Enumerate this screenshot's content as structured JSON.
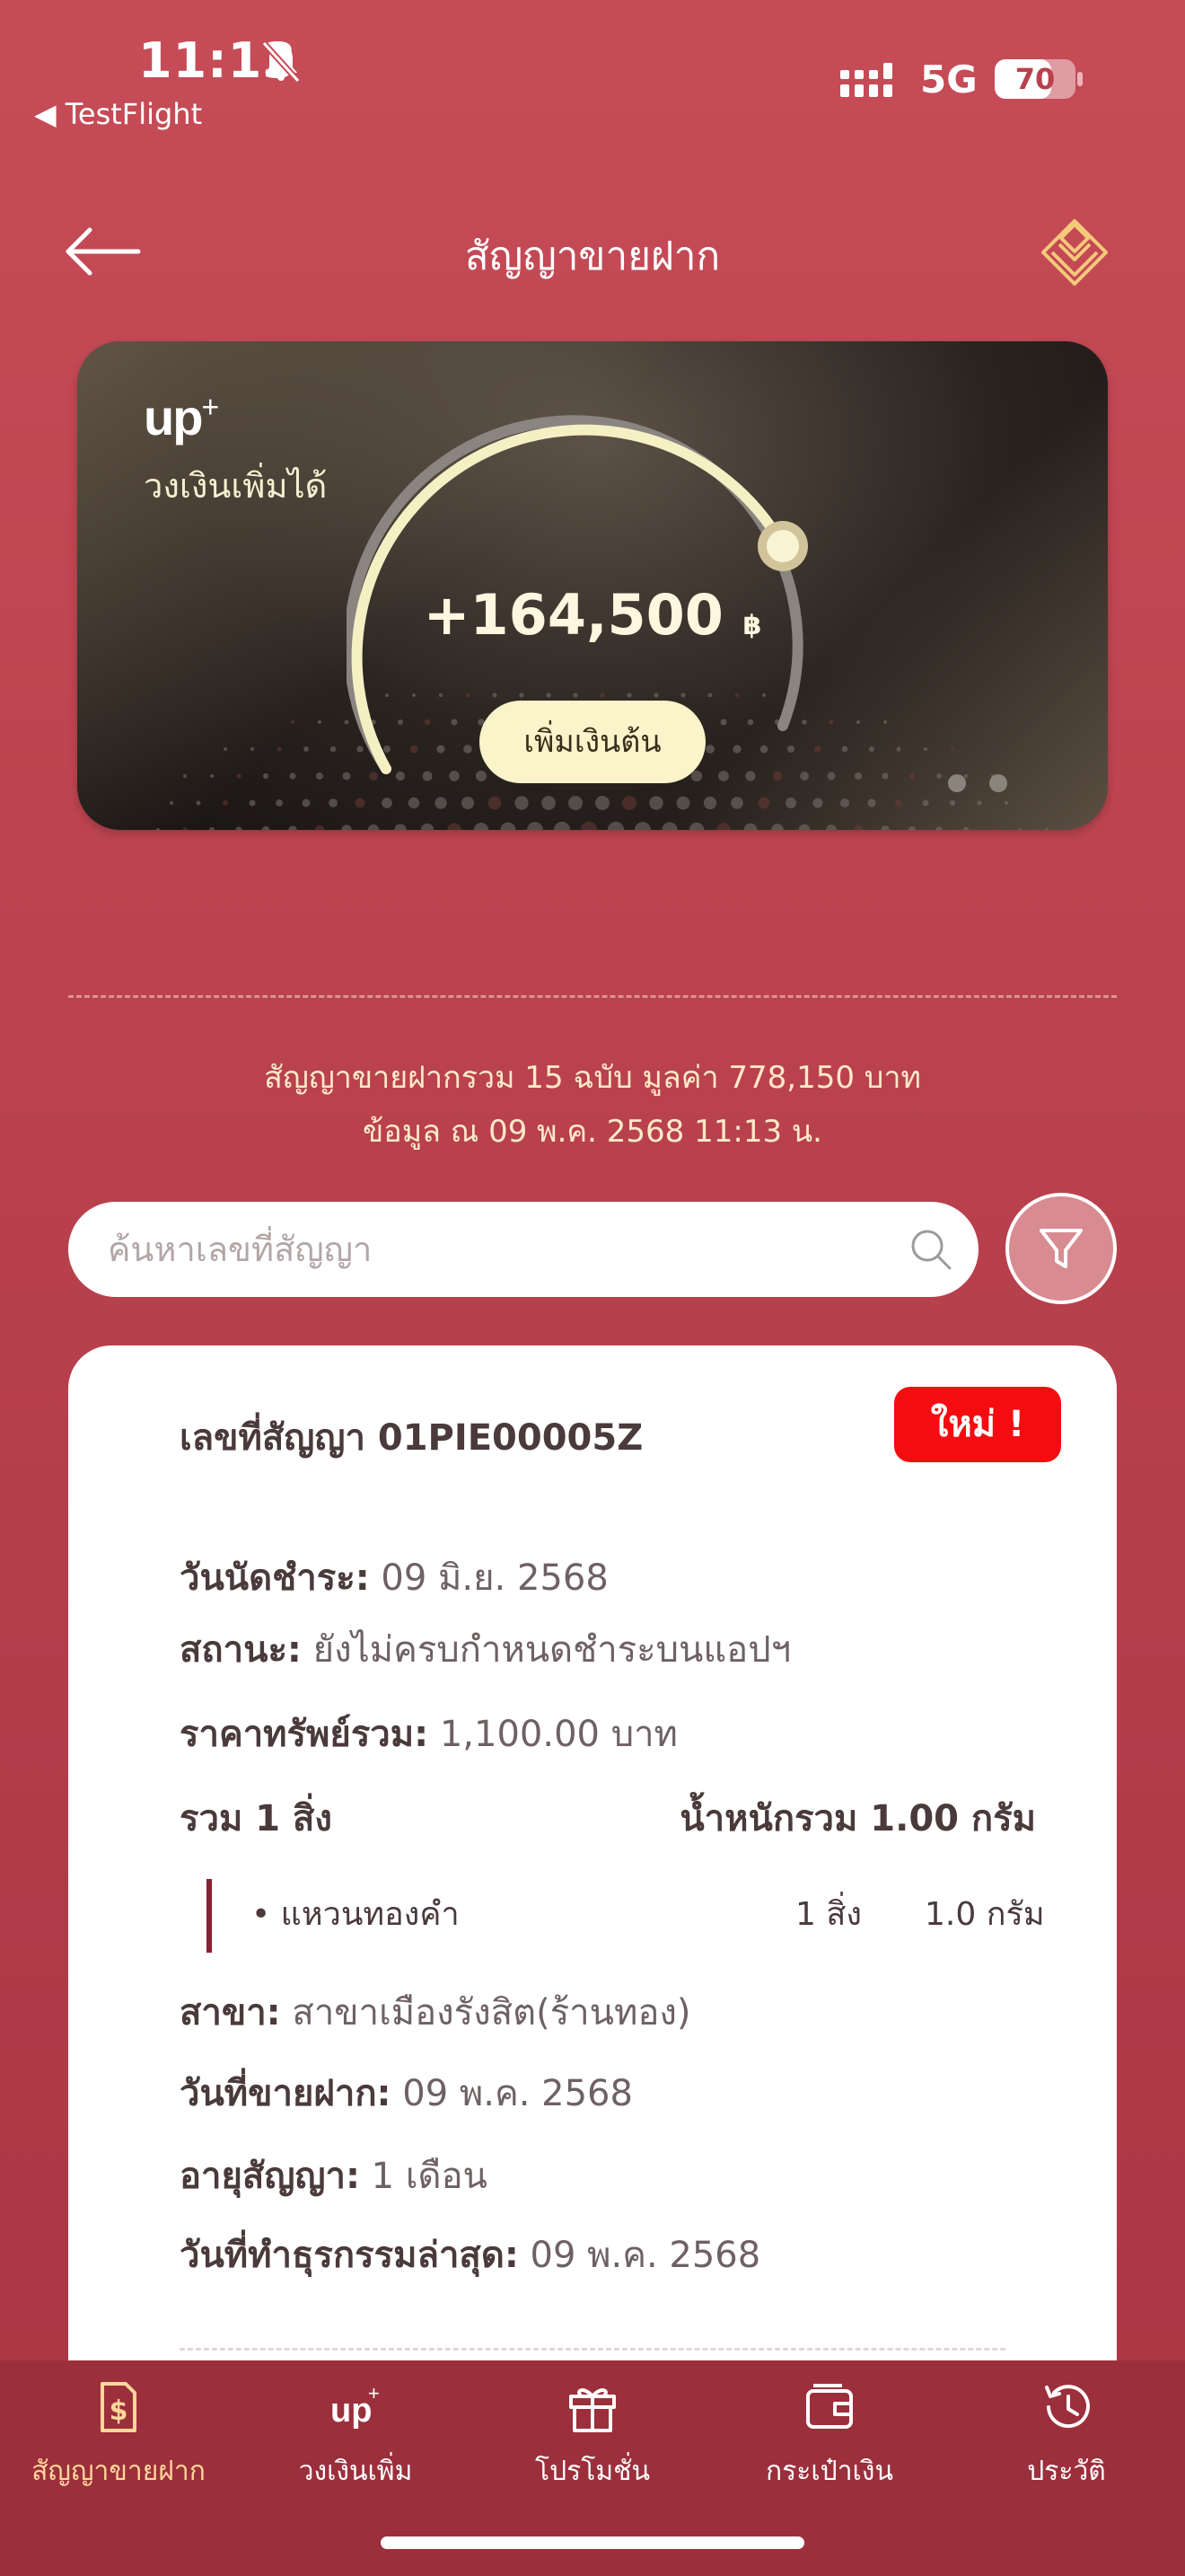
{
  "status_bar": {
    "time": "11:13",
    "back_app": "◀ TestFlight",
    "network": "5G",
    "battery": "70",
    "battery_level": 0.7
  },
  "header": {
    "title": "สัญญาขายฝาก"
  },
  "hero": {
    "logo": "up",
    "logo_sup": "+",
    "credit_label": "วงเงินเพิ่มได้",
    "amount": "+164,500",
    "currency": "฿",
    "button_label": "เพิ่มเงินต้น"
  },
  "summary": {
    "line1": "สัญญาขายฝากรวม 15 ฉบับ มูลค่า 778,150 บาท",
    "line2": "ข้อมูล ณ 09 พ.ค. 2568 11:13  น."
  },
  "search": {
    "placeholder": "ค้นหาเลขที่สัญญา",
    "value": ""
  },
  "contract": {
    "title": "เลขที่สัญญา 01PIE00005Z",
    "badge": "ใหม่ !",
    "due_label": "วันนัดชำระ:",
    "due_value": " 09 มิ.ย. 2568",
    "status_label": "สถานะ:",
    "status_value": " ยังไม่ครบกำหนดชำระบนแอปฯ",
    "price_label": "ราคาทรัพย์รวม:",
    "price_value": " 1,100.00 บาท",
    "count_label": "รวม 1 สิ่ง",
    "weight_label": "น้ำหนักรวม 1.00 กรัม",
    "items": [
      {
        "name": "• แหวนทองคำ",
        "qty": "1 สิ่ง",
        "weight": "1.0 กรัม"
      }
    ],
    "branch_label": "สาขา:",
    "branch_value": " สาขาเมืองรังสิต(ร้านทอง)",
    "sale_date_label": "วันที่ขายฝาก:",
    "sale_date_value": " 09 พ.ค. 2568",
    "term_label": "อายุสัญญา:",
    "term_value": " 1 เดือน",
    "last_tx_label": "วันที่ทำธุรกรรมล่าสุด:",
    "last_tx_value": " 09 พ.ค. 2568"
  },
  "nav": [
    {
      "label": "สัญญาขายฝาก",
      "icon": "contract-dollar-icon",
      "active": true
    },
    {
      "label": "วงเงินเพิ่ม",
      "icon": "up-plus-icon",
      "active": false
    },
    {
      "label": "โปรโมชั่น",
      "icon": "gift-icon",
      "active": false
    },
    {
      "label": "กระเป๋าเงิน",
      "icon": "wallet-icon",
      "active": false
    },
    {
      "label": "ประวัติ",
      "icon": "history-icon",
      "active": false
    }
  ],
  "colors": {
    "background": "#c64c57",
    "accent": "#ffd79a",
    "badge": "#f50c10",
    "gauge": "#f5efc4"
  }
}
